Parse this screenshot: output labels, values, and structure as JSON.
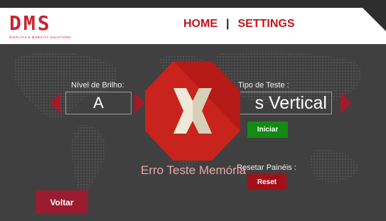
{
  "header": {
    "logo_text": "DMS",
    "logo_tagline": "DISPLAYS & MOBILITY SOLUTIONS",
    "nav": {
      "home": "HOME",
      "separator": "|",
      "settings": "SETTINGS"
    }
  },
  "brightness": {
    "label": "Nível de Brilho:",
    "value": "A"
  },
  "test_type": {
    "label": "Tipo de Teste :",
    "value": "s Vertical"
  },
  "buttons": {
    "iniciar": "Iniciar",
    "reset": "Reset",
    "voltar": "Voltar"
  },
  "reset_panels": {
    "label": "Resetar Painéis :"
  },
  "error": {
    "message": "Erro Teste Memória"
  },
  "colors": {
    "brand_red": "#c4161c",
    "arrow_red": "#a5192b",
    "start_green": "#138a13",
    "background": "#404040",
    "error_octagon": "#c9231d"
  },
  "icons": {
    "error": "error-x-icon",
    "left": "arrow-left-icon",
    "right": "arrow-right-icon"
  }
}
